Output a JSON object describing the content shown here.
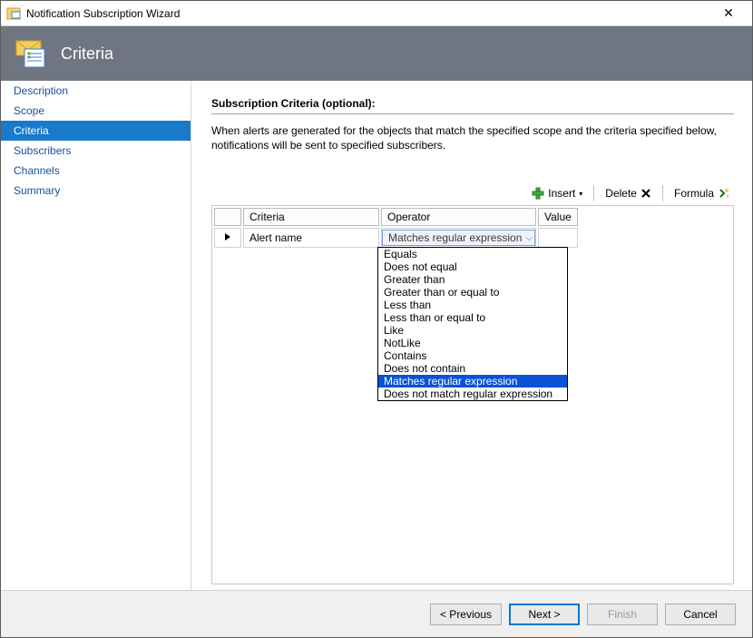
{
  "window": {
    "title": "Notification Subscription Wizard"
  },
  "banner": {
    "title": "Criteria"
  },
  "sidebar": {
    "items": [
      {
        "label": "Description",
        "selected": false
      },
      {
        "label": "Scope",
        "selected": false
      },
      {
        "label": "Criteria",
        "selected": true
      },
      {
        "label": "Subscribers",
        "selected": false
      },
      {
        "label": "Channels",
        "selected": false
      },
      {
        "label": "Summary",
        "selected": false
      }
    ]
  },
  "section": {
    "title": "Subscription Criteria (optional):",
    "description": "When alerts are generated for the objects that match the specified scope and the criteria specified below, notifications will be sent to specified subscribers."
  },
  "toolbar": {
    "insert": "Insert",
    "delete": "Delete",
    "formula": "Formula"
  },
  "grid": {
    "columns": {
      "criteria": "Criteria",
      "operator": "Operator",
      "value": "Value"
    },
    "rows": [
      {
        "criteria": "Alert name",
        "operator_display": "Matches regular expression",
        "value": ""
      }
    ]
  },
  "operator_dropdown": {
    "options": [
      "Equals",
      "Does not equal",
      "Greater than",
      "Greater than or equal to",
      "Less than",
      "Less than or equal to",
      "Like",
      "NotLike",
      "Contains",
      "Does not contain",
      "Matches regular expression",
      "Does not match regular expression"
    ],
    "selected_index": 10
  },
  "footer": {
    "previous": "< Previous",
    "next": "Next >",
    "finish": "Finish",
    "cancel": "Cancel"
  }
}
